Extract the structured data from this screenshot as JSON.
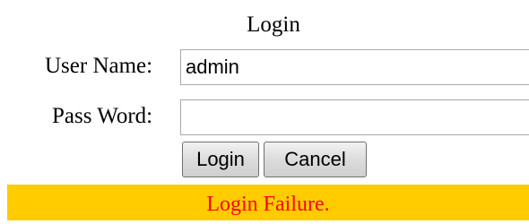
{
  "form": {
    "title": "Login",
    "username_label": "User Name:",
    "username_value": "admin",
    "password_label": "Pass Word:",
    "password_value": ""
  },
  "buttons": {
    "login_label": "Login",
    "cancel_label": "Cancel"
  },
  "status": {
    "message": "Login Failure.",
    "background_color": "#ffcc00",
    "text_color": "#ff0000"
  }
}
